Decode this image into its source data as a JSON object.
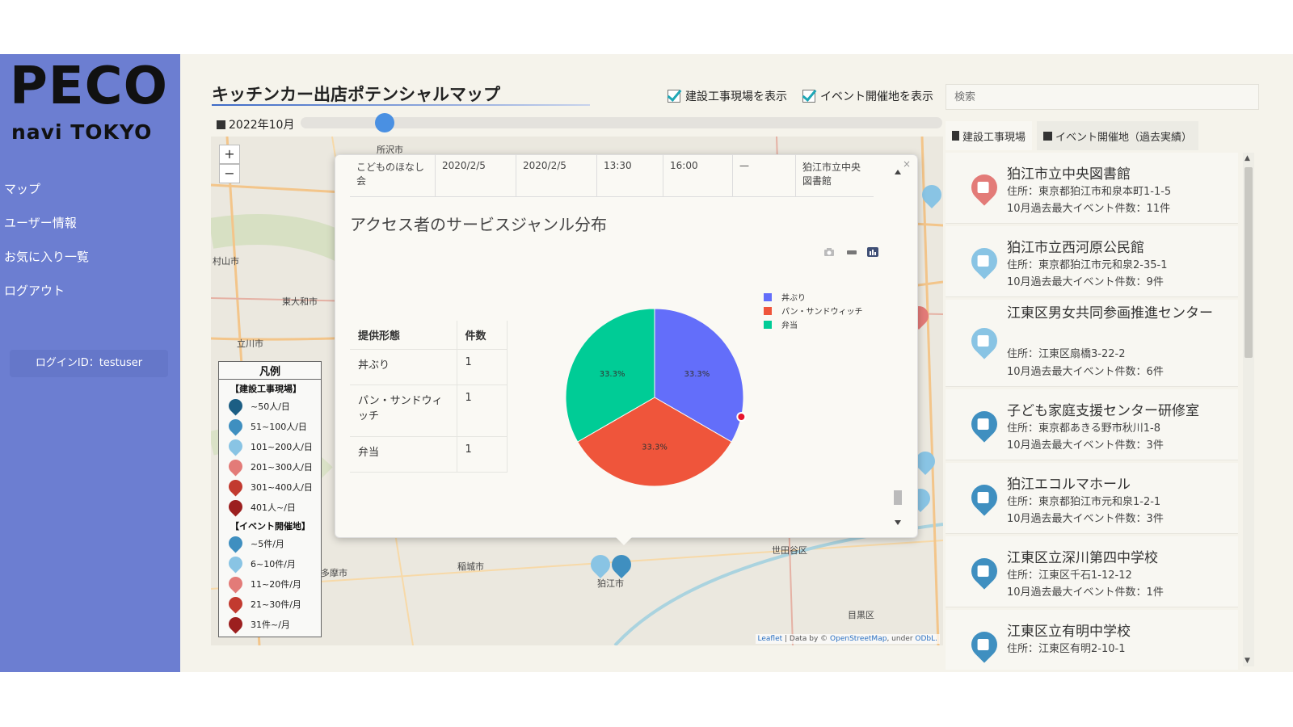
{
  "logo": {
    "title": "PECO",
    "subtitle": "navi TOKYO"
  },
  "sidebar": {
    "items": [
      {
        "label": "マップ"
      },
      {
        "label": "ユーザー情報"
      },
      {
        "label": "お気に入り一覧"
      },
      {
        "label": "ログアウト"
      }
    ],
    "login_label": "ログインID：testuser"
  },
  "header": {
    "title": "キッチンカー出店ポテンシャルマップ",
    "checkbox_construction": "建設工事現場を表示",
    "checkbox_event": "イベント開催地を表示",
    "search_placeholder": "検索"
  },
  "slider": {
    "date_label": "2022年10月"
  },
  "map": {
    "zoom_in": "+",
    "zoom_out": "−",
    "place_labels": [
      "所沢市",
      "東大和市",
      "立川市",
      "稲城市",
      "多摩市",
      "世田谷区",
      "目黒区",
      "村山市",
      "狛江市"
    ],
    "attribution_leaflet": "Leaflet",
    "attribution_text": " | Data by © ",
    "attribution_osm": "OpenStreetMap",
    "attribution_under": ", under ",
    "attribution_odbl": "ODbL."
  },
  "legend": {
    "title": "凡例",
    "construction_heading": "【建設工事現場】",
    "construction_items": [
      "~50人/日",
      "51~100人/日",
      "101~200人/日",
      "201~300人/日",
      "301~400人/日",
      "401人~/日"
    ],
    "event_heading": "【イベント開催地】",
    "event_items": [
      "~5件/月",
      "6~10件/月",
      "11~20件/月",
      "21~30件/月",
      "31件~/月"
    ],
    "colors": [
      "#1c5e84",
      "#3f8fc0",
      "#89c4e4",
      "#e37b78",
      "#c23a2f",
      "#9c1f1f"
    ]
  },
  "popup": {
    "top_row": [
      "こどものほなし会",
      "2020/2/5",
      "2020/2/5",
      "13:30",
      "16:00",
      "—",
      "狛江市立中央図書館"
    ],
    "heading": "アクセス者のサービスジャンル分布",
    "close": "×",
    "table": {
      "headers": [
        "提供形態",
        "件数"
      ],
      "rows": [
        [
          "丼ぶり",
          "1"
        ],
        [
          "パン・サンドウィッチ",
          "1"
        ],
        [
          "弁当",
          "1"
        ]
      ]
    }
  },
  "chart_data": {
    "type": "pie",
    "title": "アクセス者のサービスジャンル分布",
    "categories": [
      "丼ぶり",
      "パン・サンドウィッチ",
      "弁当"
    ],
    "values": [
      33.3,
      33.3,
      33.3
    ],
    "labels": [
      "33.3%",
      "33.3%",
      "33.3%"
    ],
    "colors": [
      "#636efa",
      "#ef553b",
      "#00cc96"
    ],
    "legend_position": "top-right"
  },
  "tabs": {
    "construction": "建設工事現場",
    "event": "イベント開催地（過去実績）"
  },
  "list": [
    {
      "name": "狛江市立中央図書館",
      "address": "住所：東京都狛江市和泉本町1-1-5",
      "count": "10月過去最大イベント件数：11件",
      "color": "#e37b78"
    },
    {
      "name": "狛江市立西河原公民館",
      "address": "住所：東京都狛江市元和泉2-35-1",
      "count": "10月過去最大イベント件数：9件",
      "color": "#89c4e4"
    },
    {
      "name": "江東区男女共同参画推進センター",
      "address": "住所：江東区扇橋3-22-2",
      "count": "10月過去最大イベント件数：6件",
      "color": "#89c4e4"
    },
    {
      "name": "子ども家庭支援センター研修室",
      "address": "住所：東京都あきる野市秋川1-8",
      "count": "10月過去最大イベント件数：3件",
      "color": "#3f8fc0"
    },
    {
      "name": "狛江エコルマホール",
      "address": "住所：東京都狛江市元和泉1-2-1",
      "count": "10月過去最大イベント件数：3件",
      "color": "#3f8fc0"
    },
    {
      "name": "江東区立深川第四中学校",
      "address": "住所：江東区千石1-12-12",
      "count": "10月過去最大イベント件数：1件",
      "color": "#3f8fc0"
    },
    {
      "name": "江東区立有明中学校",
      "address": "住所：江東区有明2-10-1",
      "count": "",
      "color": "#3f8fc0"
    }
  ]
}
